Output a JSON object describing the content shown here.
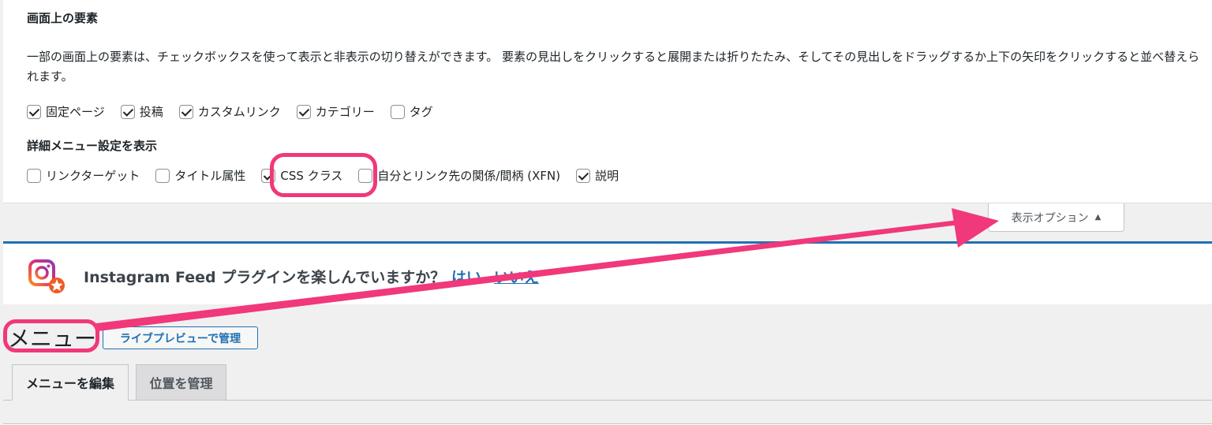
{
  "screen_options": {
    "title": "画面上の要素",
    "description": "一部の画面上の要素は、チェックボックスを使って表示と非表示の切り替えができます。 要素の見出しをクリックすると展開または折りたたみ、そしてその見出しをドラッグするか上下の矢印をクリックすると並べ替えられます。",
    "boxes": [
      {
        "label": "固定ページ",
        "checked": true
      },
      {
        "label": "投稿",
        "checked": true
      },
      {
        "label": "カスタムリンク",
        "checked": true
      },
      {
        "label": "カテゴリー",
        "checked": true
      },
      {
        "label": "タグ",
        "checked": false
      }
    ],
    "advanced_heading": "詳細メニュー設定を表示",
    "advanced": [
      {
        "label": "リンクターゲット",
        "checked": false
      },
      {
        "label": "タイトル属性",
        "checked": false
      },
      {
        "label": "CSS クラス",
        "checked": true
      },
      {
        "label": "自分とリンク先の関係/間柄 (XFN)",
        "checked": false
      },
      {
        "label": "説明",
        "checked": true
      }
    ],
    "toggle_label": "表示オプション",
    "toggle_caret": "▲"
  },
  "notice": {
    "text": "Instagram Feed プラグインを楽しんでいますか？",
    "yes_label": "はい",
    "no_label": "いいえ"
  },
  "page": {
    "title": "メニュー",
    "live_preview_button": "ライブプレビューで管理"
  },
  "tabs": [
    {
      "label": "メニューを編集",
      "active": true
    },
    {
      "label": "位置を管理",
      "active": false
    }
  ],
  "colors": {
    "highlight": "#f0387a",
    "accent": "#2271b1"
  }
}
